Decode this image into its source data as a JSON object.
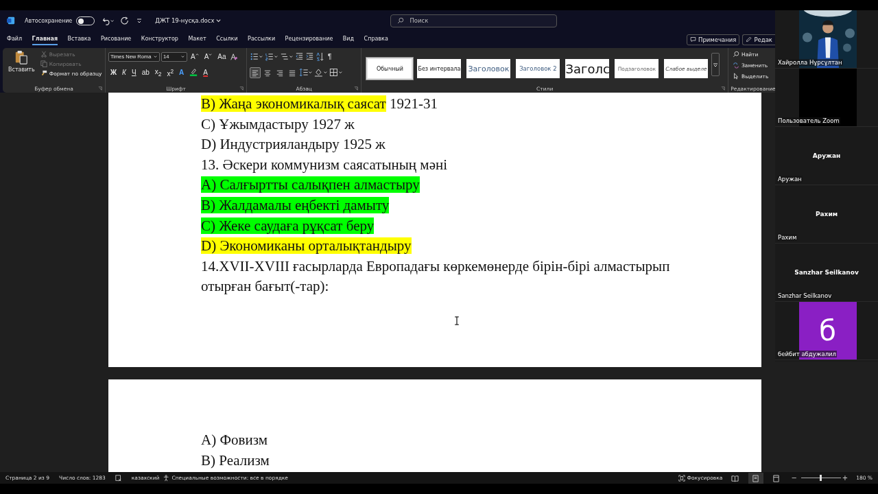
{
  "title_bar": {
    "autosave_label": "Автосохранение",
    "autosave_on": false,
    "document_name": "ДЖТ 19-нусқа.docx",
    "search": {
      "placeholder": "Поиск"
    }
  },
  "menu_tabs": [
    {
      "label": "Файл",
      "selected": false
    },
    {
      "label": "Главная",
      "selected": true
    },
    {
      "label": "Вставка",
      "selected": false
    },
    {
      "label": "Рисование",
      "selected": false
    },
    {
      "label": "Конструктор",
      "selected": false
    },
    {
      "label": "Макет",
      "selected": false
    },
    {
      "label": "Ссылки",
      "selected": false
    },
    {
      "label": "Рассылки",
      "selected": false
    },
    {
      "label": "Рецензирование",
      "selected": false
    },
    {
      "label": "Вид",
      "selected": false
    },
    {
      "label": "Справка",
      "selected": false
    }
  ],
  "menu_actions": [
    {
      "label": "Примечания",
      "kind": "comments"
    },
    {
      "label": "Редак",
      "kind": "edit"
    }
  ],
  "ribbon": {
    "clipboard": {
      "title": "Буфер обмена",
      "paste": "Вставить",
      "items": [
        {
          "label": "Вырезать",
          "kind": "cut",
          "disabled": true
        },
        {
          "label": "Копировать",
          "kind": "copy",
          "disabled": true
        },
        {
          "label": "Формат по образцу",
          "kind": "painter",
          "disabled": false
        }
      ]
    },
    "font": {
      "title": "Шрифт",
      "font_name": "Times New Roma",
      "font_size": "14",
      "size_buttons": [
        {
          "label": "A",
          "kind": "grow"
        },
        {
          "label": "A",
          "kind": "shrink"
        },
        {
          "label": "Aa",
          "kind": "case"
        }
      ],
      "format_buttons": [
        {
          "label": "Ж",
          "kind": "bold"
        },
        {
          "label": "К",
          "kind": "italic"
        },
        {
          "label": "Ч",
          "kind": "underline"
        },
        {
          "label": "ab",
          "kind": "strike"
        },
        {
          "label": "x$_{2}$",
          "kind": "sub"
        },
        {
          "label": "x$^{2}$",
          "kind": "sup"
        },
        {
          "label": "A",
          "kind": "effects"
        },
        {
          "kind": "highlight"
        },
        {
          "label": "A",
          "kind": "color"
        }
      ]
    },
    "paragraph": {
      "title": "Абзац",
      "pilcrow": "¶",
      "align_buttons": [
        {
          "kind": "left",
          "selected": true
        },
        {
          "kind": "center",
          "selected": false
        },
        {
          "kind": "right",
          "selected": false
        },
        {
          "kind": "justify",
          "selected": false
        }
      ]
    },
    "styles": {
      "title": "Стили",
      "items": [
        {
          "label": "Обычный",
          "kind": "normal",
          "selected": true
        },
        {
          "label": "Без интервала",
          "kind": "nospacing",
          "selected": false
        },
        {
          "label": "Заголовок",
          "kind": "heading1",
          "selected": false
        },
        {
          "label": "Заголовок 2",
          "kind": "heading2",
          "selected": false
        },
        {
          "label": "Заголс",
          "kind": "title",
          "selected": false
        },
        {
          "label": "Подзаголовок",
          "kind": "subtitle",
          "selected": false
        },
        {
          "label": "Слабое выделе",
          "kind": "emphasis",
          "selected": false
        }
      ]
    },
    "editing": {
      "title": "Редактирование",
      "items": [
        {
          "label": "Найти",
          "kind": "find"
        },
        {
          "label": "Заменить",
          "kind": "replace"
        },
        {
          "label": "Выделить",
          "kind": "select"
        }
      ]
    }
  },
  "document": {
    "page_1": [
      {
        "segments": [
          {
            "text": "B) Жаңа экономикалық саясат",
            "color": "#ffff00"
          },
          {
            "text": " 1921-31"
          }
        ]
      },
      {
        "segments": [
          {
            "text": "C) Ұжымдастыру 1927 ж"
          }
        ]
      },
      {
        "segments": [
          {
            "text": "D) Индустрияландыру 1925 ж"
          }
        ]
      },
      {
        "segments": [
          {
            "text": "13. Әскери коммунизм саясатының мәні"
          }
        ]
      },
      {
        "segments": [
          {
            "text": "A) Салғыртты салықпен алмастыру",
            "color": "#00ff00"
          }
        ]
      },
      {
        "segments": [
          {
            "text": "B) Жалдамалы еңбекті дамыту",
            "color": "#00ff00"
          }
        ]
      },
      {
        "segments": [
          {
            "text": "C) Жеке саудаға рұқсат беру",
            "color": "#00ff00"
          }
        ]
      },
      {
        "segments": [
          {
            "text": "D) Экономиканы орталықтандыру",
            "color": "#ffff00"
          }
        ]
      },
      {
        "segments": [
          {
            "text": "14.XVII-XVIII ғасырларда Европадағы көркемөнерде бірін-бірі алмастырып отырған бағыт(-тар):"
          }
        ]
      }
    ],
    "page_2": [
      {
        "segments": [
          {
            "text": "A) Фовизм"
          }
        ]
      },
      {
        "segments": [
          {
            "text": "B) Реализм"
          }
        ]
      }
    ]
  },
  "status_bar": {
    "page": "Страница 2 из 9",
    "words": "Число слов: 1283",
    "language": "казахский",
    "accessibility": "Специальные возможности: все в порядке",
    "focus": "Фокусировка",
    "views": [
      {
        "kind": "read",
        "selected": false
      },
      {
        "kind": "print",
        "selected": true
      },
      {
        "kind": "web",
        "selected": false
      }
    ],
    "zoom": {
      "zoom_out": "−",
      "level": 0.48,
      "zoom_in": "+",
      "reading": "180 %"
    }
  },
  "participants": [
    {
      "name": "Хайролла Нұрсұлтан",
      "kind": "video"
    },
    {
      "name": "Пользователь Zoom",
      "kind": "camera_off"
    },
    {
      "name": "Аружан",
      "center_name": "Аружан",
      "kind": "name_only"
    },
    {
      "name": "Рахим",
      "center_name": "Рахим",
      "kind": "name_only"
    },
    {
      "name": "Sanzhar Seilkanov",
      "center_name": "Sanzhar Seilkanov",
      "kind": "name_only"
    },
    {
      "name": "бейбит абдужалил",
      "initial": "б",
      "color": "#8a1fc4",
      "kind": "avatar"
    }
  ]
}
